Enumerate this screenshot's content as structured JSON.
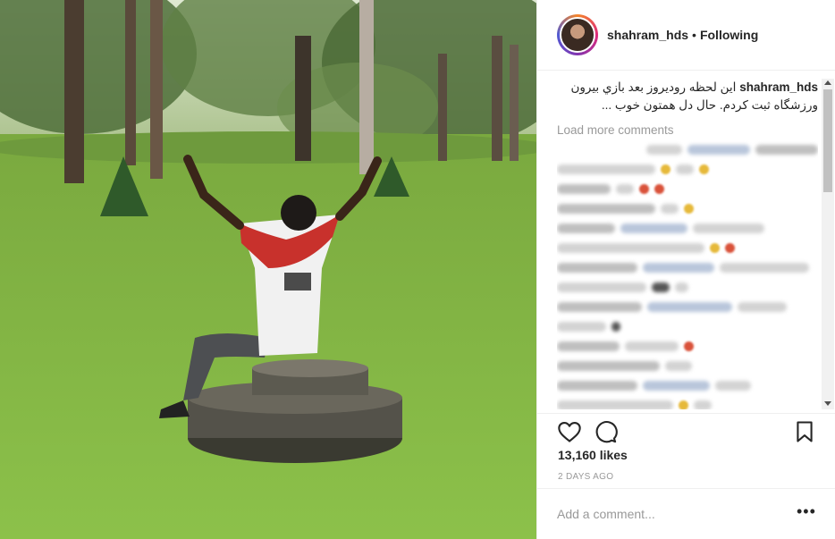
{
  "post": {
    "username": "shahram_hds",
    "separator": "•",
    "follow_status": "Following",
    "caption_user": "shahram_hds",
    "caption_text": "اين لحظه روديروز بعد بازي بيرون ورزشگاه ثبت كردم. حال دل همتون خوب ...",
    "load_more": "Load more comments",
    "likes": "13,160 likes",
    "date": "2 DAYS AGO",
    "add_comment_placeholder": "Add a comment...",
    "more_label": "•••"
  },
  "icons": {
    "like": "heart-icon",
    "comment": "comment-bubble-icon",
    "save": "bookmark-icon",
    "more": "more-options-icon"
  },
  "colors": {
    "text": "#262626",
    "muted": "#999999",
    "border": "#efefef",
    "link": "#003569"
  }
}
